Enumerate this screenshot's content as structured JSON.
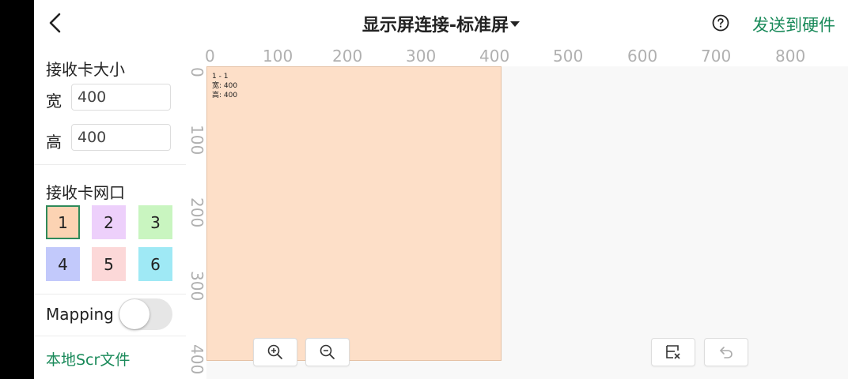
{
  "header": {
    "title": "显示屏连接-标准屏",
    "send_label": "发送到硬件"
  },
  "sidebar": {
    "size_title": "接收卡大小",
    "width_label": "宽",
    "width_value": "400",
    "height_label": "高",
    "height_value": "400",
    "ports_title": "接收卡网口",
    "ports": [
      {
        "label": "1",
        "color": "#fcd3b3"
      },
      {
        "label": "2",
        "color": "#edd0fb"
      },
      {
        "label": "3",
        "color": "#c9f5c0"
      },
      {
        "label": "4",
        "color": "#c2c9fb"
      },
      {
        "label": "5",
        "color": "#fcd8d8"
      },
      {
        "label": "6",
        "color": "#9fe9f5"
      }
    ],
    "mapping_label": "Mapping",
    "mapping_on": false,
    "local_scr_label": "本地Scr文件"
  },
  "canvas": {
    "x_ticks": [
      "0",
      "100",
      "200",
      "300",
      "400",
      "500",
      "600",
      "700",
      "800"
    ],
    "y_ticks": [
      "0",
      "100",
      "200",
      "300",
      "400"
    ],
    "screen": {
      "id_text": "1 - 1",
      "width_text": "宽: 400",
      "height_text": "高: 400",
      "width": 400,
      "height": 400,
      "color": "#fddfc8"
    },
    "tools": [
      "zoom-in",
      "zoom-out",
      "clear-screen",
      "undo"
    ]
  },
  "colors": {
    "accent": "#1a8a5a",
    "selected_border": "#2f8a5a"
  }
}
